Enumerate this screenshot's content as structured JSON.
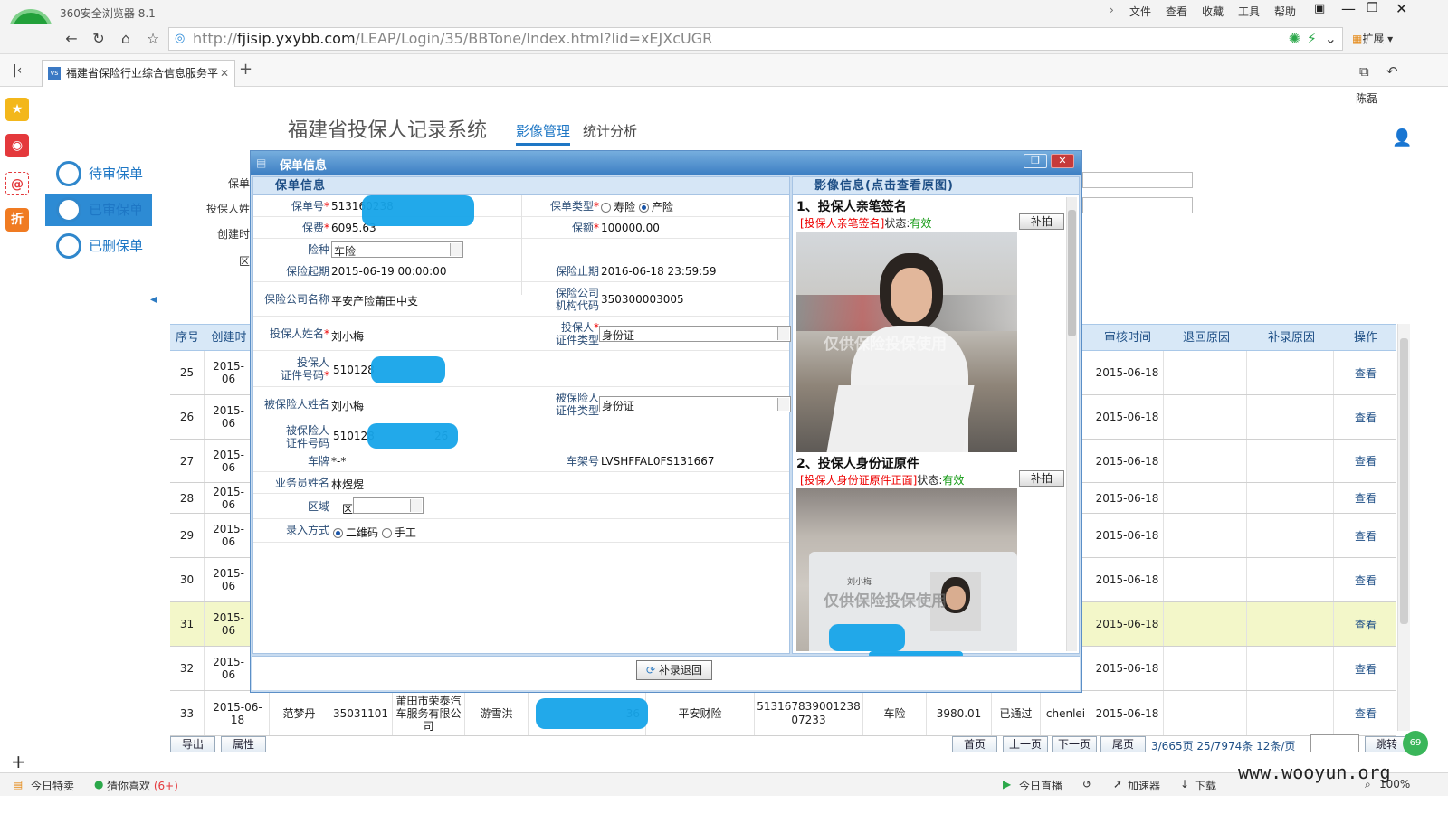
{
  "browser": {
    "app_title": "360安全浏览器 8.1",
    "menu": [
      "文件",
      "查看",
      "收藏",
      "工具",
      "帮助"
    ],
    "url_prefix": "http://",
    "url_host": "fjisip.yxybb.com",
    "url_path": "/LEAP/Login/35/BBTone/Index.html?lid=xEJXcUGR",
    "extend_label": "扩展",
    "tab_title": "福建省保险行业综合信息服务平",
    "user_name": "陈磊"
  },
  "page": {
    "system_title": "福建省投保人记录系统",
    "nav": {
      "image_mgmt": "影像管理",
      "stats": "统计分析"
    },
    "left_menu": [
      "待审保单",
      "已审保单",
      "已删保单"
    ],
    "filter_labels": [
      "保单",
      "投保人姓",
      "创建时",
      "区"
    ],
    "grid_headers": {
      "seq": "序号",
      "created": "创建时",
      "review_time": "审核时间",
      "return_reason": "退回原因",
      "supp_reason": "补录原因",
      "action": "操作"
    },
    "rows": [
      {
        "seq": "25",
        "date": "2015-06",
        "review": "2015-06-18",
        "action": "查看"
      },
      {
        "seq": "26",
        "date": "2015-06",
        "review": "2015-06-18",
        "action": "查看"
      },
      {
        "seq": "27",
        "date": "2015-06",
        "review": "2015-06-18",
        "action": "查看"
      },
      {
        "seq": "28",
        "date": "2015-06",
        "review": "2015-06-18",
        "action": "查看"
      },
      {
        "seq": "29",
        "date": "2015-06",
        "review": "2015-06-18",
        "action": "查看"
      },
      {
        "seq": "30",
        "date": "2015-06",
        "review": "2015-06-18",
        "action": "查看"
      },
      {
        "seq": "31",
        "date": "2015-06",
        "review": "2015-06-18",
        "action": "查看"
      },
      {
        "seq": "32",
        "date": "2015-06",
        "review": "2015-06-18",
        "action": "查看"
      }
    ],
    "last_row": {
      "seq": "33",
      "date": "2015-06-18",
      "name": "范梦丹",
      "code": "35031101",
      "company": "莆田市荣泰汽车服务有限公司",
      "agent": "游雪洪",
      "id_tail": "36",
      "insurer": "平安财险",
      "policy": "51316783900123807233",
      "kind": "车险",
      "amount": "3980.01",
      "status": "已通过",
      "user": "chenlei",
      "review": "2015-06-18",
      "action": "查看"
    },
    "buttons": {
      "export": "导出",
      "props": "属性"
    },
    "pager": {
      "first": "首页",
      "prev": "上一页",
      "next": "下一页",
      "last": "尾页",
      "info": "3/665页 25/7974条 12条/页",
      "jump": "跳转"
    }
  },
  "modal": {
    "title": "保单信息",
    "left_section": "保单信息",
    "right_section": "影像信息(点击查看原图)",
    "fields": {
      "policy_no_label": "保单号",
      "policy_no": "513160238",
      "policy_type_label": "保单类型",
      "type_life": "寿险",
      "type_property": "产险",
      "premium_label": "保费",
      "premium": "6095.63",
      "coverage_label": "保额",
      "coverage": "100000.00",
      "kind_label": "险种",
      "kind": "车险",
      "start_label": "保险起期",
      "start": "2015-06-19 00:00:00",
      "end_label": "保险止期",
      "end": "2016-06-18 23:59:59",
      "company_label": "保险公司名称",
      "company": "平安产险莆田中支",
      "org_code_label_1": "保险公司",
      "org_code_label_2": "机构代码",
      "org_code": "350300003005",
      "holder_name_label": "投保人姓名",
      "holder_name": "刘小梅",
      "holder_idtype_label_1": "投保人",
      "holder_idtype_label_2": "证件类型",
      "holder_idtype": "身份证",
      "holder_id_label_1": "投保人",
      "holder_id_label_2": "证件号码",
      "holder_id": "510128",
      "insured_name_label": "被保险人姓名",
      "insured_name": "刘小梅",
      "insured_idtype_label_1": "被保险人",
      "insured_idtype_label_2": "证件类型",
      "insured_idtype": "身份证",
      "insured_id_label_1": "被保险人",
      "insured_id_label_2": "证件号码",
      "insured_id": "510128",
      "insured_id_tail": "26",
      "plate_label": "车牌",
      "plate": "*-*",
      "vin_label": "车架号",
      "vin": "LVSHFFAL0FS131667",
      "agent_label": "业务员姓名",
      "agent": "林煜煜",
      "region_label": "区域",
      "region": "区",
      "entry_label": "录入方式",
      "entry_qr": "二维码",
      "entry_manual": "手工"
    },
    "images": [
      {
        "title": "1、投保人亲笔签名",
        "tag": "[投保人亲笔签名]",
        "state_label": "状态:",
        "state": "有效",
        "button": "补拍",
        "watermark": "仅供保险投保使用"
      },
      {
        "title": "2、投保人身份证原件",
        "tag": "[投保人身份证原件正面]",
        "state_label": "状态:",
        "state": "有效",
        "button": "补拍",
        "watermark": "仅供保险投保使用",
        "card_name": "刘小梅"
      }
    ],
    "footer_button": "补录退回"
  },
  "statusbar": {
    "today_deals": "今日特卖",
    "guess": "猜你喜欢",
    "guess_count": "(6+)",
    "live": "今日直播",
    "accelerator": "加速器",
    "download": "下载",
    "zoom": "100%",
    "watermark": "www.wooyun.org"
  }
}
